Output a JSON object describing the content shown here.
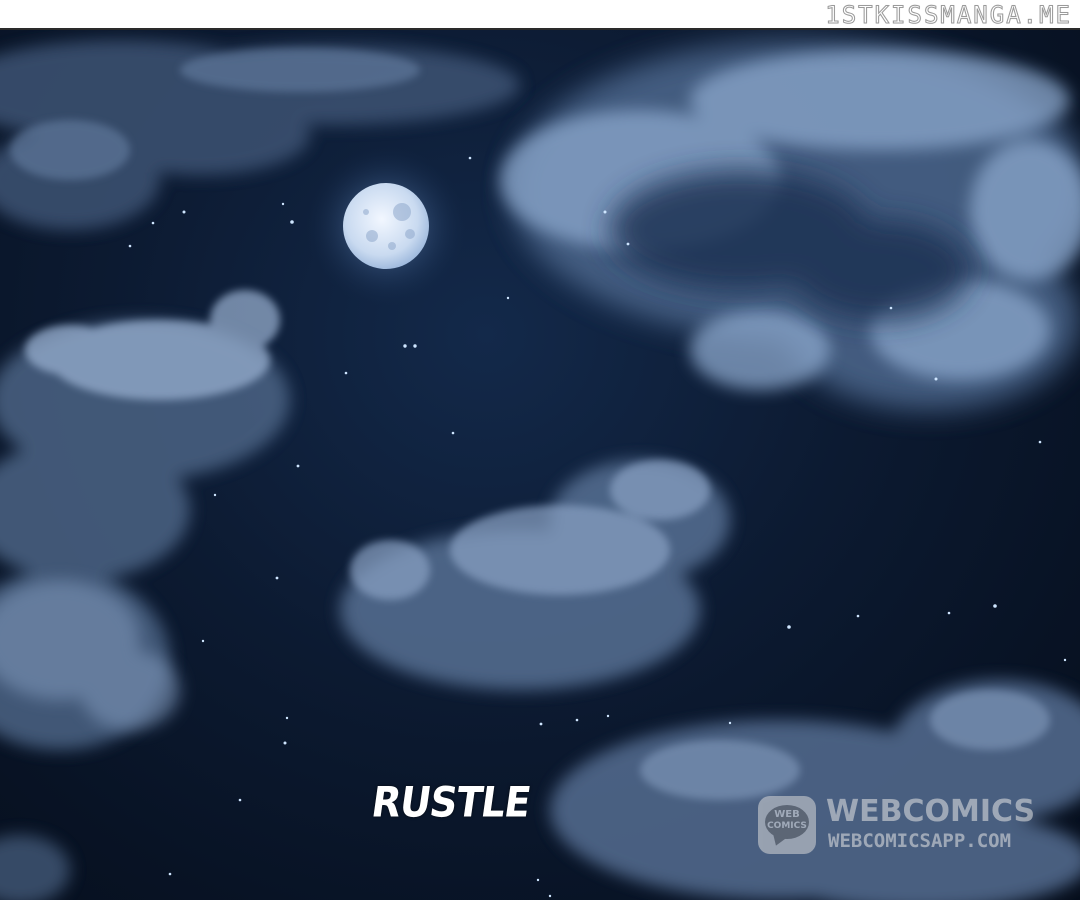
{
  "site_watermark": "1STKISSMANGA.ME",
  "sound_effect": "RUSTLE",
  "brand": {
    "logo_line1": "WEB",
    "logo_line2": "COMICS",
    "name": "WEBCOMICS",
    "url": "WEBCOMICSAPP.COM"
  },
  "colors": {
    "sky_dark": "#081325",
    "sky_mid": "#13294a",
    "cloud": "#8fa8c8",
    "moon": "#d6e4f5",
    "star": "#cfe6ff"
  },
  "icons": [
    "moon-icon",
    "webcomics-logo-icon"
  ]
}
